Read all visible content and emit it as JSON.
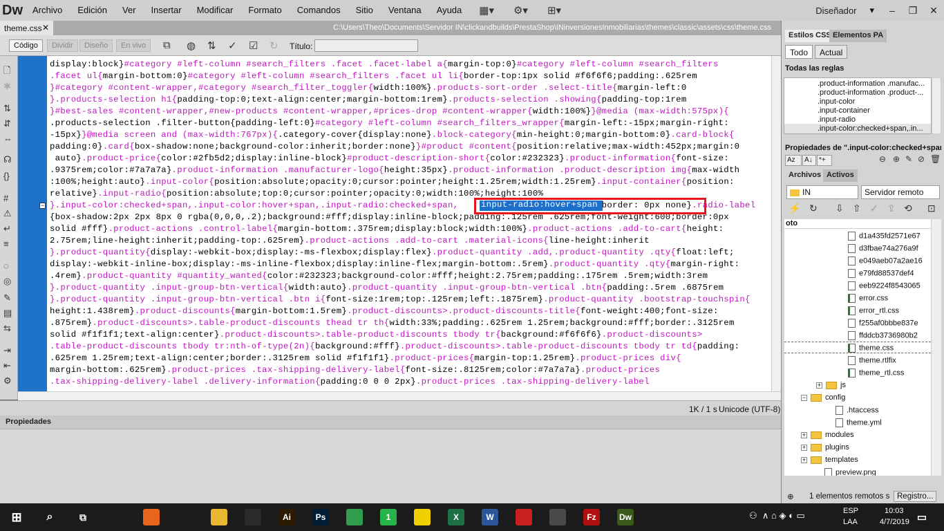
{
  "app": {
    "logo": "Dw",
    "menu": [
      "Archivo",
      "Edición",
      "Ver",
      "Insertar",
      "Modificar",
      "Formato",
      "Comandos",
      "Sitio",
      "Ventana",
      "Ayuda"
    ],
    "workspace": "Diseñador"
  },
  "document": {
    "tab": "theme.css",
    "close": "✕",
    "path": "C:\\Users\\Theo\\Documents\\Servidor IN\\clickandbuilds\\PrestaShop\\INinversionesInmobiliarias\\themes\\classic\\assets\\css\\theme.css"
  },
  "toolbar": {
    "views": [
      "Código",
      "Dividir",
      "Diseño",
      "En vivo"
    ],
    "title_label": "Título:",
    "title_value": ""
  },
  "code": {
    "lines": [
      [
        [
          "v",
          "display:block}"
        ],
        [
          "p",
          "#category #left-column #search_filters .facet .facet-label a{"
        ],
        [
          "v",
          "margin-top:0}"
        ],
        [
          "p",
          "#category #left-column #search_filters"
        ]
      ],
      [
        [
          "p",
          ".facet ul{"
        ],
        [
          "v",
          "margin-bottom:0}"
        ],
        [
          "p",
          "#category #left-column #search_filters .facet ul li{"
        ],
        [
          "v",
          "border-top:1px solid #f6f6f6;padding:.625rem"
        ]
      ],
      [
        [
          "p",
          "}#category #content-wrapper,#category #search_filter_toggler{"
        ],
        [
          "v",
          "width:100%}"
        ],
        [
          "p",
          ".products-sort-order .select-title{"
        ],
        [
          "v",
          "margin-left:0"
        ]
      ],
      [
        [
          "p",
          "}.products-selection h1{"
        ],
        [
          "v",
          "padding-top:0;text-align:center;margin-bottom:1rem}"
        ],
        [
          "p",
          ".products-selection .showing{"
        ],
        [
          "v",
          "padding-top:1rem"
        ]
      ],
      [
        [
          "p",
          "}#best-sales #content-wrapper,#new-products #content-wrapper,#prices-drop #content-wrapper{"
        ],
        [
          "v",
          "width:100%}"
        ],
        [
          "p",
          "}@media (max-width:575px){"
        ]
      ],
      [
        [
          "v",
          ".products-selection .filter-button{padding-left:0}"
        ],
        [
          "p",
          "#category #left-column #search_filters_wrapper{"
        ],
        [
          "v",
          "margin-left:-15px;margin-right:"
        ]
      ],
      [
        [
          "v",
          "-15px}"
        ],
        [
          "p",
          "}@media screen and (max-width:767px){"
        ],
        [
          "v",
          ".category-cover{display:none}"
        ],
        [
          "p",
          ".block-category{"
        ],
        [
          "v",
          "min-height:0;margin-bottom:0}"
        ],
        [
          "p",
          ".card-block{"
        ]
      ],
      [
        [
          "v",
          "padding:0}"
        ],
        [
          "p",
          ".card{"
        ],
        [
          "v",
          "box-shadow:none;background-color:inherit;border:none}"
        ],
        [
          "p",
          "}#product #content{"
        ],
        [
          "v",
          "position:relative;max-width:452px;margin:0"
        ]
      ],
      [
        [
          "v",
          " auto}"
        ],
        [
          "p",
          ".product-price{"
        ],
        [
          "v",
          "color:#2fb5d2;display:inline-block}"
        ],
        [
          "p",
          "#product-description-short{"
        ],
        [
          "v",
          "color:#232323}"
        ],
        [
          "p",
          ".product-information{"
        ],
        [
          "v",
          "font-size:"
        ]
      ],
      [
        [
          "v",
          ".9375rem;color:#7a7a7a}"
        ],
        [
          "p",
          ".product-information .manufacturer-logo{"
        ],
        [
          "v",
          "height:35px}"
        ],
        [
          "p",
          ".product-information .product-description img{"
        ],
        [
          "v",
          "max-width"
        ]
      ],
      [
        [
          "v",
          ":100%;height:auto}"
        ],
        [
          "p",
          ".input-color{"
        ],
        [
          "v",
          "position:absolute;opacity:0;cursor:pointer;height:1.25rem;width:1.25rem}"
        ],
        [
          "p",
          ".input-container{"
        ],
        [
          "v",
          "position:"
        ]
      ],
      [
        [
          "v",
          "relative}"
        ],
        [
          "p",
          ".input-radio{"
        ],
        [
          "v",
          "position:absolute;top:0;cursor:pointer;opacity:0;width:100%;height:100%"
        ]
      ],
      [
        [
          "p",
          "}.input-color:checked+span,.input-color:hover+span,.input-radio:checked+span,"
        ],
        [
          "p",
          "                          "
        ],
        [
          "v",
          "{border: 0px none}"
        ],
        [
          "p",
          ".radio-label"
        ]
      ],
      [
        [
          "v",
          "{box-shadow:2px 2px 8px 0 rgba(0,0,0,.2);background:#fff;display:inline-block;padding:.125rem .625rem;font-weight:600;border:0px"
        ]
      ],
      [
        [
          "v",
          "solid #fff}"
        ],
        [
          "p",
          ".product-actions .control-label{"
        ],
        [
          "v",
          "margin-bottom:.375rem;display:block;width:100%}"
        ],
        [
          "p",
          ".product-actions .add-to-cart{"
        ],
        [
          "v",
          "height:"
        ]
      ],
      [
        [
          "v",
          "2.75rem;line-height:inherit;padding-top:.625rem}"
        ],
        [
          "p",
          ".product-actions .add-to-cart .material-icons{"
        ],
        [
          "v",
          "line-height:inherit"
        ]
      ],
      [
        [
          "p",
          "}.product-quantity{"
        ],
        [
          "v",
          "display:-webkit-box;display:-ms-flexbox;display:flex}"
        ],
        [
          "p",
          ".product-quantity .add,.product-quantity .qty{"
        ],
        [
          "v",
          "float:left;"
        ]
      ],
      [
        [
          "v",
          "display:-webkit-inline-box;display:-ms-inline-flexbox;display:inline-flex;margin-bottom:.5rem}"
        ],
        [
          "p",
          ".product-quantity .qty{"
        ],
        [
          "v",
          "margin-right:"
        ]
      ],
      [
        [
          "v",
          ".4rem}"
        ],
        [
          "p",
          ".product-quantity #quantity_wanted{"
        ],
        [
          "v",
          "color:#232323;background-color:#fff;height:2.75rem;padding:.175rem .5rem;width:3rem"
        ]
      ],
      [
        [
          "p",
          "}.product-quantity .input-group-btn-vertical{"
        ],
        [
          "v",
          "width:auto}"
        ],
        [
          "p",
          ".product-quantity .input-group-btn-vertical .btn{"
        ],
        [
          "v",
          "padding:.5rem .6875rem"
        ]
      ],
      [
        [
          "p",
          "}.product-quantity .input-group-btn-vertical .btn i{"
        ],
        [
          "v",
          "font-size:1rem;top:.125rem;left:.1875rem}"
        ],
        [
          "p",
          ".product-quantity .bootstrap-touchspin{"
        ]
      ],
      [
        [
          "v",
          "height:1.438rem}"
        ],
        [
          "p",
          ".product-discounts{"
        ],
        [
          "v",
          "margin-bottom:1.5rem}"
        ],
        [
          "p",
          ".product-discounts>.product-discounts-title{"
        ],
        [
          "v",
          "font-weight:400;font-size:"
        ]
      ],
      [
        [
          "v",
          ".875rem}"
        ],
        [
          "p",
          ".product-discounts>.table-product-discounts thead tr th{"
        ],
        [
          "v",
          "width:33%;padding:.625rem 1.25rem;background:#fff;border:.3125rem"
        ]
      ],
      [
        [
          "v",
          "solid #f1f1f1;text-align:center}"
        ],
        [
          "p",
          ".product-discounts>.table-product-discounts tbody tr{"
        ],
        [
          "v",
          "background:#f6f6f6}"
        ],
        [
          "p",
          ".product-discounts>"
        ]
      ],
      [
        [
          "p",
          ".table-product-discounts tbody tr:nth-of-type(2n){"
        ],
        [
          "v",
          "background:#fff}"
        ],
        [
          "p",
          ".product-discounts>.table-product-discounts tbody tr td{"
        ],
        [
          "v",
          "padding:"
        ]
      ],
      [
        [
          "v",
          ".625rem 1.25rem;text-align:center;border:.3125rem solid #f1f1f1}"
        ],
        [
          "p",
          ".product-prices{"
        ],
        [
          "v",
          "margin-top:1.25rem}"
        ],
        [
          "p",
          ".product-prices div{"
        ]
      ],
      [
        [
          "v",
          "margin-bottom:.625rem}"
        ],
        [
          "p",
          ".product-prices .tax-shipping-delivery-label{"
        ],
        [
          "v",
          "font-size:.8125rem;color:#7a7a7a}"
        ],
        [
          "p",
          ".product-prices"
        ]
      ],
      [
        [
          "p",
          ".tax-shipping-delivery-label .delivery-information{"
        ],
        [
          "v",
          "padding:0 0 0 2px}"
        ],
        [
          "p",
          ".product-prices .tax-shipping-delivery-label"
        ]
      ]
    ],
    "selection": "input-radio:hover+span"
  },
  "status": {
    "size": "1K / 1 s",
    "encoding": "Unicode (UTF-8)"
  },
  "panels": {
    "properties_title": "Propiedades",
    "css_tabs": [
      "Estilos CSS",
      "Elementos PA"
    ],
    "mode_buttons": [
      "Todo",
      "Actual"
    ],
    "all_rules_label": "Todas las reglas",
    "rules": [
      ".product-information .manufac...",
      ".product-information .product-...",
      ".input-color",
      ".input-container",
      ".input-radio",
      ".input-color:checked+span,.in..."
    ],
    "props_for": "Propiedades de \".input-color:checked+span,...",
    "files_tabs": [
      "Archivos",
      "Activos"
    ],
    "site": "IN",
    "server": "Servidor remoto",
    "tree_header": "oto",
    "files": [
      {
        "name": "d1a435fd2571e67",
        "kind": "img",
        "indent": 92
      },
      {
        "name": "d3fbae74a276a9f",
        "kind": "img",
        "indent": 92
      },
      {
        "name": "e049aeb07a2ae16",
        "kind": "img",
        "indent": 92
      },
      {
        "name": "e79fd88537def4",
        "kind": "doc",
        "indent": 92
      },
      {
        "name": "eeb9224f8543065",
        "kind": "doc",
        "indent": 92
      },
      {
        "name": "error.css",
        "kind": "css",
        "indent": 92
      },
      {
        "name": "error_rtl.css",
        "kind": "css",
        "indent": 92
      },
      {
        "name": "f255af0bbbe837e",
        "kind": "img",
        "indent": 92
      },
      {
        "name": "ffddcb3736980b2",
        "kind": "img",
        "indent": 92
      },
      {
        "name": "theme.css",
        "kind": "css",
        "indent": 92
      },
      {
        "name": "theme.rtlfix",
        "kind": "doc",
        "indent": 92
      },
      {
        "name": "theme_rtl.css",
        "kind": "css",
        "indent": 92
      },
      {
        "name": "js",
        "kind": "dir",
        "indent": 62,
        "plus": true
      },
      {
        "name": "config",
        "kind": "dir",
        "indent": 40,
        "plus": true,
        "open": true
      },
      {
        "name": ".htaccess",
        "kind": "doc",
        "indent": 74
      },
      {
        "name": "theme.yml",
        "kind": "doc",
        "indent": 74
      },
      {
        "name": "modules",
        "kind": "dir",
        "indent": 40,
        "plus": true
      },
      {
        "name": "plugins",
        "kind": "dir",
        "indent": 40,
        "plus": true
      },
      {
        "name": "templates",
        "kind": "dir",
        "indent": 40,
        "plus": true
      },
      {
        "name": "preview.png",
        "kind": "doc",
        "indent": 58
      }
    ],
    "remote_status": "1 elementos remotos s",
    "log_button": "Registro..."
  },
  "taskbar": {
    "apps": [
      {
        "label": "",
        "color": "#1b1b1b",
        "name": "store-icon"
      },
      {
        "label": "",
        "color": "#e8661c",
        "name": "firefox-icon"
      },
      {
        "label": "",
        "color": "#1b1b1b",
        "name": "mail-icon"
      },
      {
        "label": "",
        "color": "#e8b830",
        "name": "file-explorer-icon"
      },
      {
        "label": "",
        "color": "#2a2a2a",
        "name": "calculator-icon"
      },
      {
        "label": "Ai",
        "color": "#2d1a00",
        "name": "illustrator-icon"
      },
      {
        "label": "Ps",
        "color": "#001d34",
        "name": "photoshop-icon"
      },
      {
        "label": "",
        "color": "#2f9d4a",
        "name": "chrome-icon"
      },
      {
        "label": "1",
        "color": "#25b34a",
        "name": "whatsapp-icon"
      },
      {
        "label": "",
        "color": "#f0d000",
        "name": "sticky-notes-icon"
      },
      {
        "label": "X",
        "color": "#1e7145",
        "name": "excel-icon"
      },
      {
        "label": "W",
        "color": "#2b579a",
        "name": "word-icon"
      },
      {
        "label": "",
        "color": "#c8201c",
        "name": "acrobat-icon"
      },
      {
        "label": "",
        "color": "#4a4a4a",
        "name": "paint-icon"
      },
      {
        "label": "Fz",
        "color": "#b01010",
        "name": "filezilla-icon"
      },
      {
        "label": "Dw",
        "color": "#3a5a1a",
        "name": "dreamweaver-icon"
      }
    ],
    "lang1": "ESP",
    "lang2": "LAA",
    "time": "10:03",
    "date": "4/7/2019"
  }
}
